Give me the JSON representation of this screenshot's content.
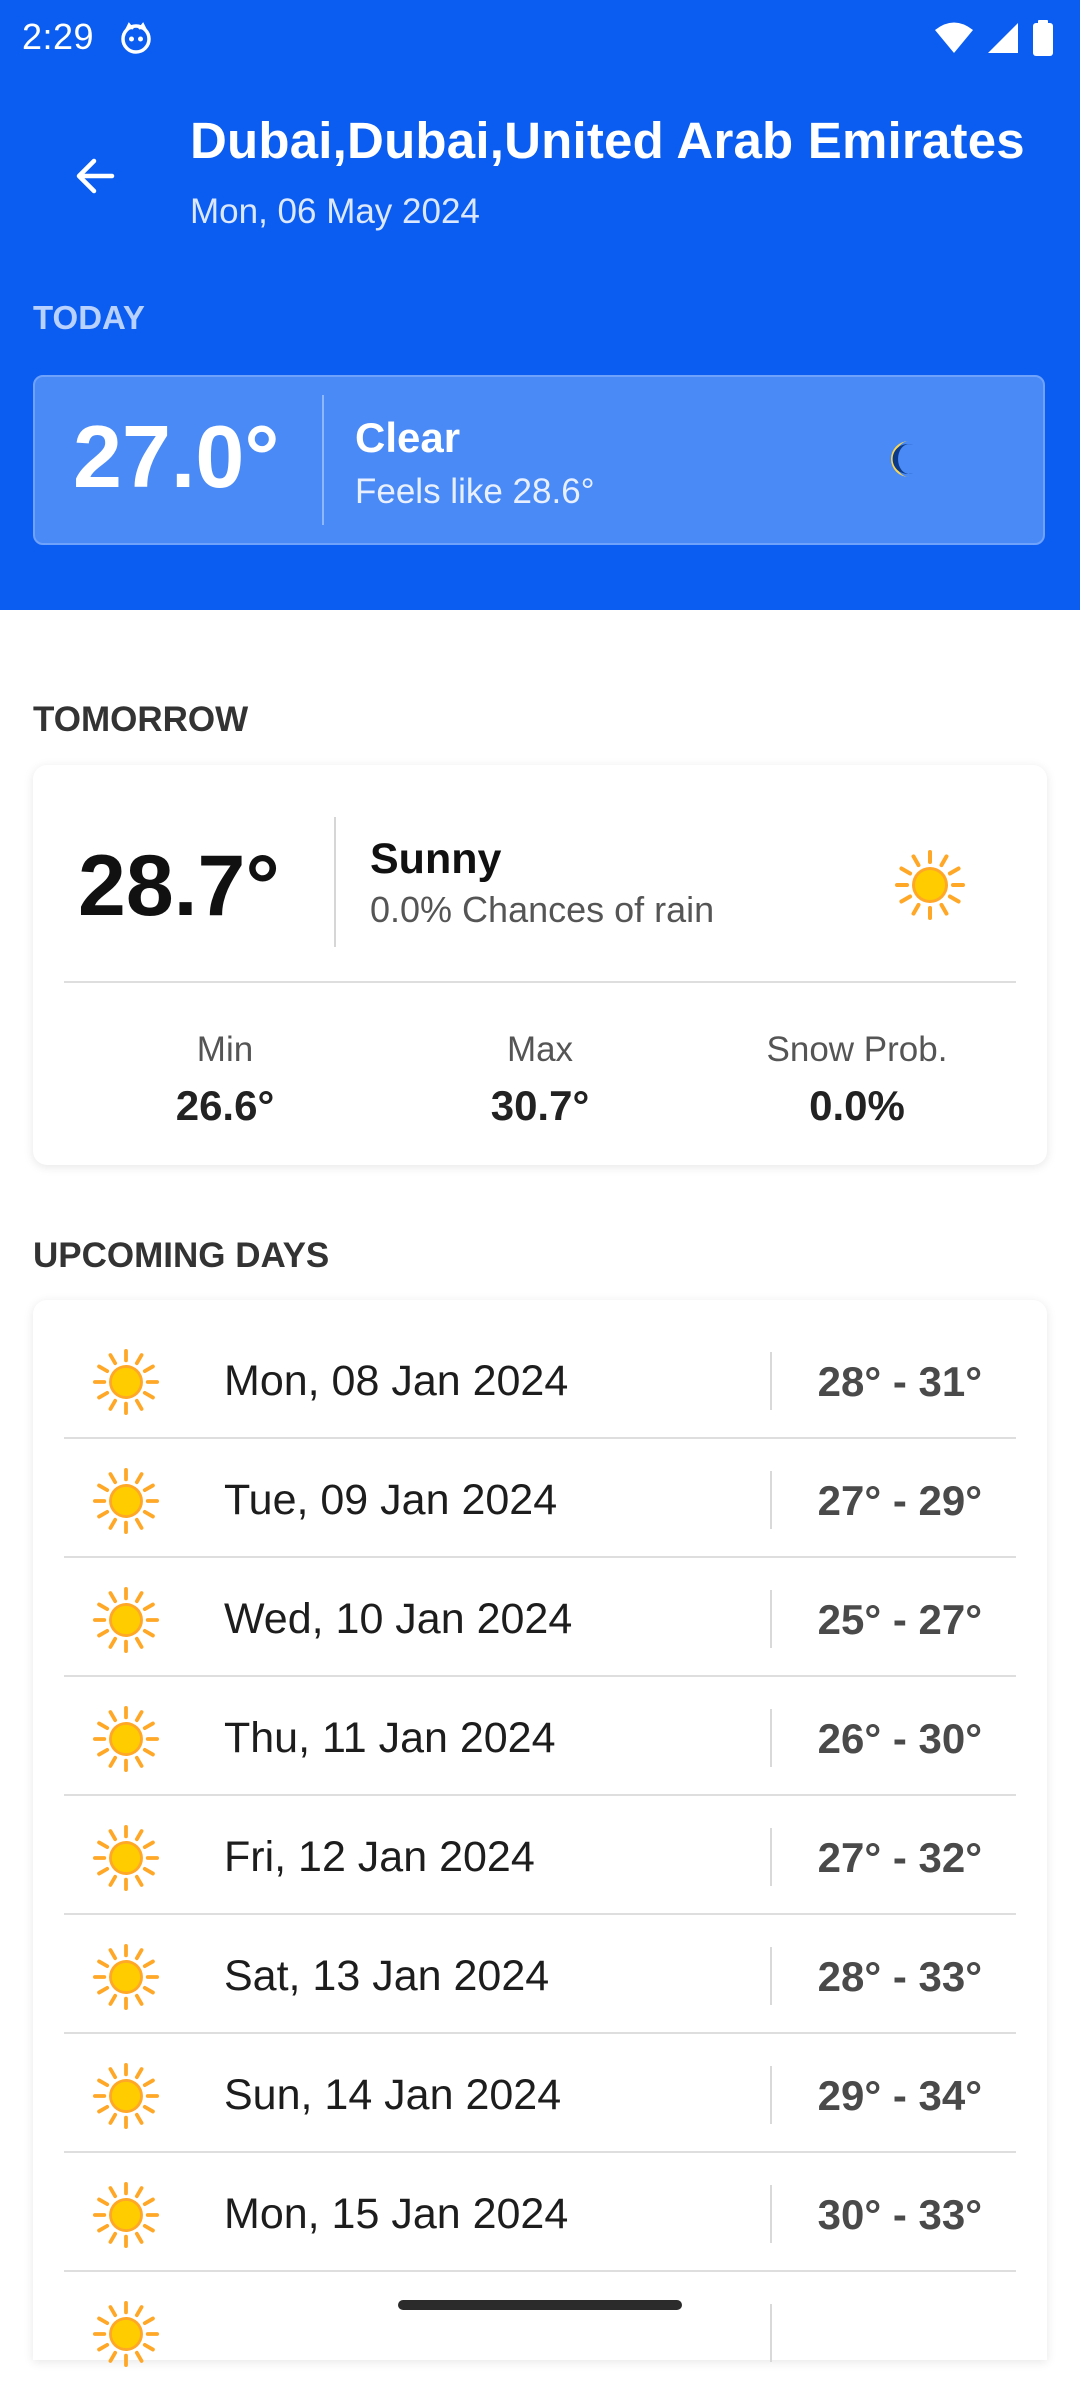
{
  "status_bar": {
    "time": "2:29"
  },
  "header": {
    "city": "Dubai,Dubai,United Arab Emirates",
    "date": "Mon, 06 May 2024"
  },
  "today": {
    "label": "TODAY",
    "temperature": "27.0°",
    "condition": "Clear",
    "feels_like": "Feels like 28.6°",
    "icon": "moon-icon"
  },
  "tomorrow": {
    "label": "TOMORROW",
    "temperature": "28.7°",
    "condition": "Sunny",
    "rain_chance": "0.0% Chances of rain",
    "icon": "sun-icon",
    "stats": [
      {
        "label": "Min",
        "value": "26.6°"
      },
      {
        "label": "Max",
        "value": "30.7°"
      },
      {
        "label": "Snow Prob.",
        "value": "0.0%"
      }
    ]
  },
  "upcoming": {
    "label": "UPCOMING DAYS",
    "days": [
      {
        "date": "Mon, 08 Jan 2024",
        "range": "28° - 31°",
        "icon": "sun-icon"
      },
      {
        "date": "Tue, 09 Jan 2024",
        "range": "27° - 29°",
        "icon": "sun-icon"
      },
      {
        "date": "Wed, 10 Jan 2024",
        "range": "25° - 27°",
        "icon": "sun-icon"
      },
      {
        "date": "Thu, 11 Jan 2024",
        "range": "26° - 30°",
        "icon": "sun-icon"
      },
      {
        "date": "Fri, 12 Jan 2024",
        "range": "27° - 32°",
        "icon": "sun-icon"
      },
      {
        "date": "Sat, 13 Jan 2024",
        "range": "28° - 33°",
        "icon": "sun-icon"
      },
      {
        "date": "Sun, 14 Jan 2024",
        "range": "29° - 34°",
        "icon": "sun-icon"
      },
      {
        "date": "Mon, 15 Jan 2024",
        "range": "30° - 33°",
        "icon": "sun-icon"
      }
    ]
  },
  "colors": {
    "header_blue": "#0a5df0",
    "today_card_blue": "#4a8af6",
    "sun_yellow": "#ffcc00",
    "sun_orange": "#ffa726"
  }
}
